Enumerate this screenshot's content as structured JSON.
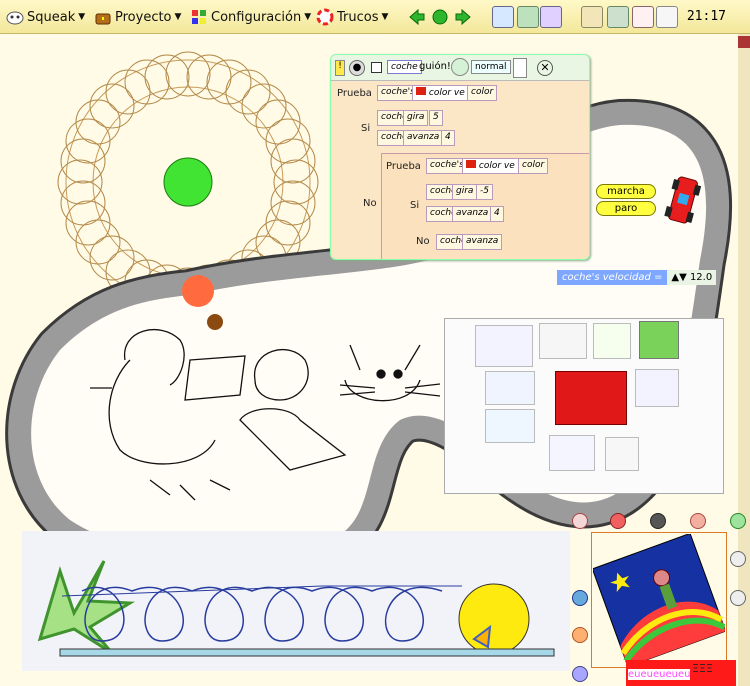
{
  "menubar": {
    "items": [
      {
        "label": "Squeak"
      },
      {
        "label": "Proyecto"
      },
      {
        "label": "Configuración"
      },
      {
        "label": "Trucos"
      }
    ],
    "clock": "21:17"
  },
  "script": {
    "object_name": "coche",
    "script_name": "guión!",
    "tick": "normal",
    "test_label": "Prueba",
    "if_label": "Si",
    "else_label": "No",
    "test_tile_obj": "coche's",
    "test_tile_prop": "color ve",
    "test_tile_value": "color",
    "turn_obj": "coche",
    "turn_cmd": "gira",
    "turn_value": "5",
    "turn_value_neg": "-5",
    "forward_cmd": "avanza",
    "forward_value": "4"
  },
  "buttons": {
    "start": "marcha",
    "stop": "paro"
  },
  "watcher": {
    "label": "coche's velocidad =",
    "value": "12.0"
  },
  "bottom_label": "eueueueueu",
  "bottom_label2": "ΞΞΞ"
}
